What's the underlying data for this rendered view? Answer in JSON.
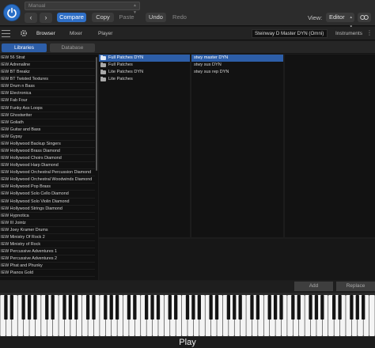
{
  "host": {
    "preset": "Manual",
    "compare_label": "Compare",
    "copy_label": "Copy",
    "paste_label": "Paste",
    "undo_label": "Undo",
    "redo_label": "Redo",
    "view_label": "View:",
    "view_value": "Editor",
    "accent_color": "#2f6fc6"
  },
  "plugin": {
    "tabs": [
      "Browser",
      "Mixer",
      "Player"
    ],
    "instrument_name": "Steinway D Master DYN (Omni)",
    "instruments_label": "Instruments"
  },
  "browser": {
    "libraries_tab": "Libraries",
    "database_tab": "Database",
    "libraries": [
      "IEW 56 Strat",
      "IEW Adrenaline",
      "IEW BT Breakz",
      "IEW BT Twisted Textures",
      "IEW Drum n Bass",
      "IEW Electronica",
      "IEW Fab Four",
      "IEW Funky Ass Loops",
      "IEW Ghostwriter",
      "IEW Goliath",
      "IEW Guitar and Bass",
      "IEW Gypsy",
      "IEW Hollywood Backup Singers",
      "IEW Hollywood Brass Diamond",
      "IEW Hollywood Choirs Diamond",
      "IEW Hollywood Harp Diamond",
      "IEW Hollywood Orchestral Percussion Diamond",
      "IEW Hollywood Orchestral Woodwinds Diamond",
      "IEW Hollywood Pop Brass",
      "IEW Hollywood Solo Cello Diamond",
      "IEW Hollywood Solo Violin Diamond",
      "IEW Hollywood Strings Diamond",
      "IEW Hypnotica",
      "IEW III Jointz",
      "IEW Joey Kramer Drums",
      "IEW Ministry Of Rock 2",
      "IEW Ministry of Rock",
      "IEW Percussive Adventures 1",
      "IEW Percussive Adventures 2",
      "IEW Phat and Phunky",
      "IEW Pianos Gold"
    ],
    "patches": [
      {
        "label": "Full Patches DYN",
        "selected": true
      },
      {
        "label": "Full Patches",
        "selected": false
      },
      {
        "label": "Lite Patches DYN",
        "selected": false
      },
      {
        "label": "Lite Patches",
        "selected": false
      }
    ],
    "presets": [
      {
        "label": "stwy master DYN",
        "selected": true
      },
      {
        "label": "stwy sus DYN",
        "selected": false
      },
      {
        "label": "stwy sus rep DYN",
        "selected": false
      }
    ],
    "add_label": "Add",
    "replace_label": "Replace"
  },
  "player": {
    "play_label": "Play"
  }
}
